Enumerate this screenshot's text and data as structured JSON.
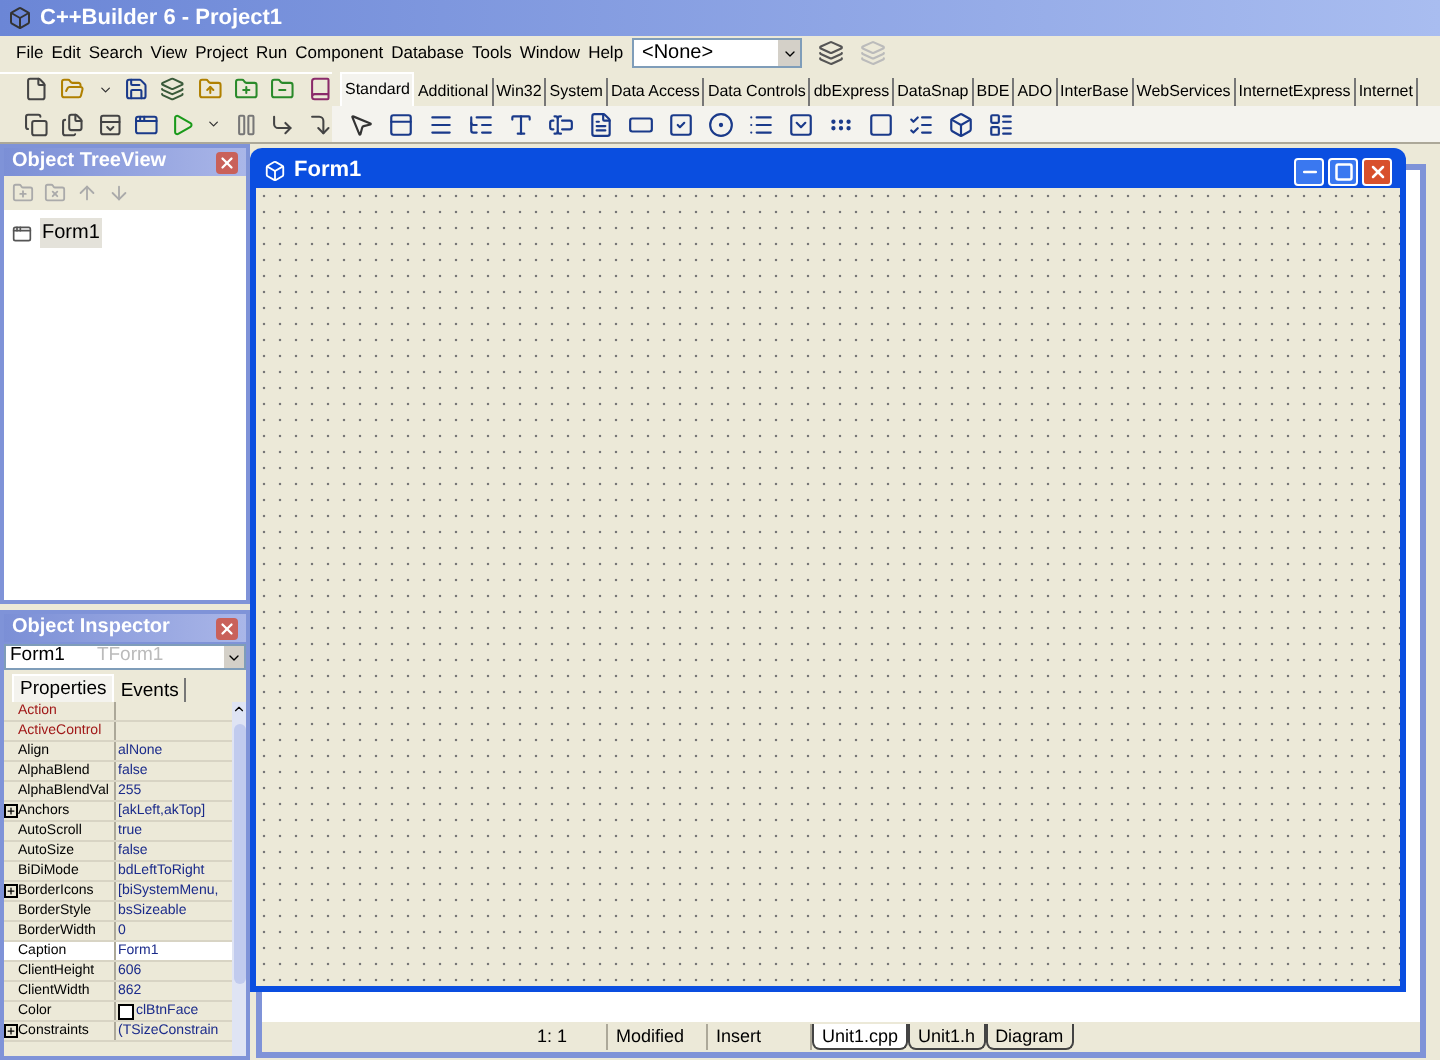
{
  "window": {
    "title": "C++Builder 6 - Project1"
  },
  "menu": [
    "File",
    "Edit",
    "Search",
    "View",
    "Project",
    "Run",
    "Component",
    "Database",
    "Tools",
    "Window",
    "Help"
  ],
  "component_combo": {
    "value": "<None>"
  },
  "palette_tabs": [
    {
      "label": "Standard",
      "selected": true
    },
    {
      "label": "Additional",
      "selected": false
    },
    {
      "label": "Win32",
      "selected": false
    },
    {
      "label": "System",
      "selected": false
    },
    {
      "label": "Data Access",
      "selected": false
    },
    {
      "label": "Data Controls",
      "selected": false
    },
    {
      "label": "dbExpress",
      "selected": false
    },
    {
      "label": "DataSnap",
      "selected": false
    },
    {
      "label": "BDE",
      "selected": false
    },
    {
      "label": "ADO",
      "selected": false
    },
    {
      "label": "InterBase",
      "selected": false
    },
    {
      "label": "WebServices",
      "selected": false
    },
    {
      "label": "InternetExpress",
      "selected": false
    },
    {
      "label": "Internet",
      "selected": false
    }
  ],
  "tree_view": {
    "title": "Object TreeView",
    "items": [
      {
        "label": "Form1",
        "selected": true
      }
    ]
  },
  "inspector": {
    "title": "Object Inspector",
    "object": "Form1",
    "object_type": "TForm1",
    "tabs": [
      {
        "label": "Properties",
        "selected": true
      },
      {
        "label": "Events",
        "selected": false
      }
    ],
    "properties": [
      {
        "name": "Action",
        "kind": "link",
        "expandable": false,
        "selected": false
      },
      {
        "name": "ActiveControl",
        "kind": "link",
        "expandable": false,
        "selected": false
      },
      {
        "name": "Align",
        "value": "alNone",
        "kind": "plain",
        "expandable": false,
        "selected": false
      },
      {
        "name": "AlphaBlend",
        "value": "false",
        "kind": "plain",
        "expandable": false,
        "selected": false
      },
      {
        "name": "AlphaBlendVal",
        "value": "255",
        "kind": "plain",
        "expandable": false,
        "selected": false
      },
      {
        "name": "Anchors",
        "value": "[akLeft,akTop]",
        "kind": "plain",
        "expandable": true,
        "selected": false
      },
      {
        "name": "AutoScroll",
        "value": "true",
        "kind": "plain",
        "expandable": false,
        "selected": false
      },
      {
        "name": "AutoSize",
        "value": "false",
        "kind": "plain",
        "expandable": false,
        "selected": false
      },
      {
        "name": "BiDiMode",
        "value": "bdLeftToRight",
        "kind": "plain",
        "expandable": false,
        "selected": false
      },
      {
        "name": "BorderIcons",
        "value": "[biSystemMenu,",
        "kind": "plain",
        "expandable": true,
        "selected": false
      },
      {
        "name": "BorderStyle",
        "value": "bsSizeable",
        "kind": "plain",
        "expandable": false,
        "selected": false
      },
      {
        "name": "BorderWidth",
        "value": "0",
        "kind": "plain",
        "expandable": false,
        "selected": false
      },
      {
        "name": "Caption",
        "value": "Form1",
        "kind": "plain",
        "expandable": false,
        "selected": true
      },
      {
        "name": "ClientHeight",
        "value": "606",
        "kind": "plain",
        "expandable": false,
        "selected": false
      },
      {
        "name": "ClientWidth",
        "value": "862",
        "kind": "plain",
        "expandable": false,
        "selected": false
      },
      {
        "name": "Color",
        "value": "clBtnFace",
        "kind": "color",
        "expandable": false,
        "selected": false
      },
      {
        "name": "Constraints",
        "value": "(TSizeConstrain",
        "kind": "plain",
        "expandable": true,
        "selected": false
      }
    ]
  },
  "form": {
    "title": "Form1"
  },
  "editor": {
    "position": "1:   1",
    "modified": "Modified",
    "mode": "Insert",
    "tabs": [
      {
        "label": "Unit1.cpp",
        "selected": true
      },
      {
        "label": "Unit1.h",
        "selected": false
      },
      {
        "label": "Diagram",
        "selected": false
      }
    ]
  }
}
